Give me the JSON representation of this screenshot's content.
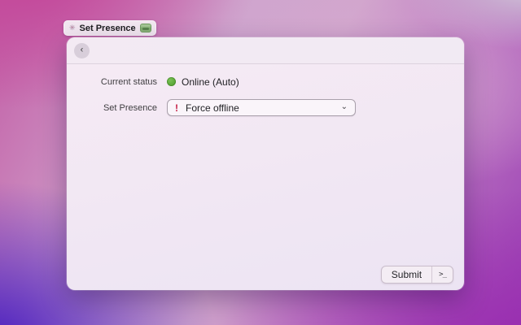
{
  "tab": {
    "title": "Set Presence"
  },
  "window": {
    "form": {
      "status_label": "Current status",
      "status_value": "Online (Auto)",
      "presence_label": "Set Presence",
      "presence_value": "Force offline"
    },
    "footer": {
      "submit_label": "Submit",
      "shortcut_label": ">_"
    }
  },
  "icons": {
    "pinwheel": "✳",
    "chevron_left": "‹",
    "chevron_down": "⌄",
    "exclamation": "!"
  },
  "colors": {
    "status_online": "#58a536",
    "warning_red": "#c41f45"
  }
}
